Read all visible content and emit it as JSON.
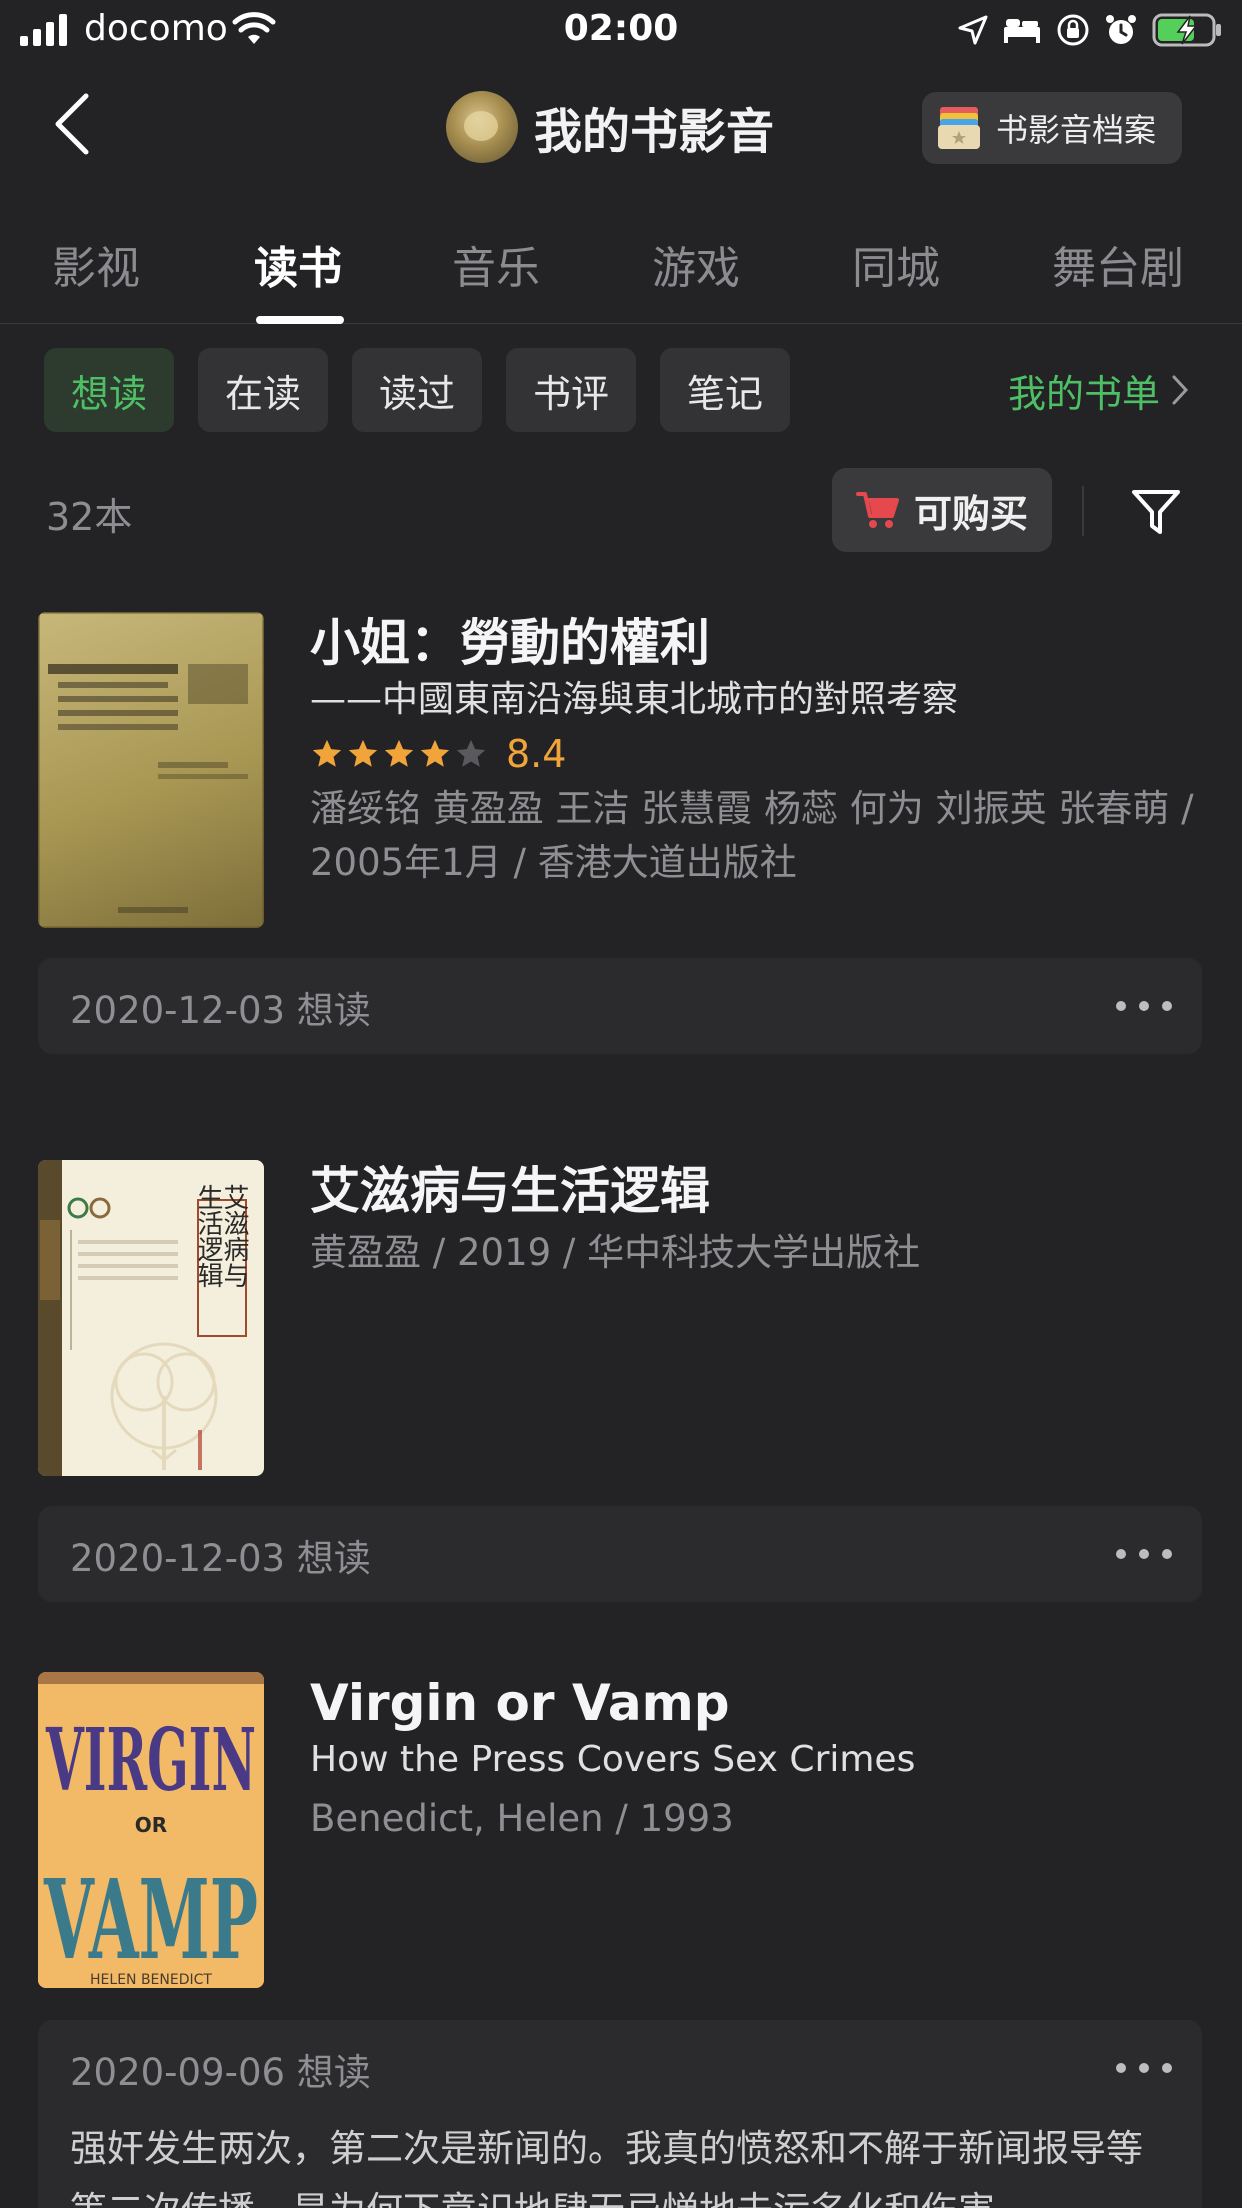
{
  "status_bar": {
    "carrier": "docomo",
    "time": "02:00"
  },
  "header": {
    "title": "我的书影音",
    "archive_label": "书影音档案"
  },
  "tabs": [
    {
      "label": "影视"
    },
    {
      "label": "读书"
    },
    {
      "label": "音乐"
    },
    {
      "label": "游戏"
    },
    {
      "label": "同城"
    },
    {
      "label": "舞台剧"
    }
  ],
  "active_tab": "读书",
  "chips": [
    {
      "label": "想读"
    },
    {
      "label": "在读"
    },
    {
      "label": "读过"
    },
    {
      "label": "书评"
    },
    {
      "label": "笔记"
    }
  ],
  "booklist_link": "我的书单",
  "count_label": "32本",
  "buy_label": "可购买",
  "books": [
    {
      "title": "小姐：勞動的權利",
      "subtitle": "——中國東南沿海與東北城市的對照考察",
      "rating": "8.4",
      "meta": "潘绥铭 黄盈盈 王洁 张慧霞 杨蕊 何为 刘振英 张春萌 / 2005年1月 / 香港大道出版社",
      "record": "2020-12-03 想读"
    },
    {
      "title": "艾滋病与生活逻辑",
      "meta": "黄盈盈 / 2019 / 华中科技大学出版社",
      "cover_text": "艾滋病与生活逻辑",
      "record": "2020-12-03 想读"
    },
    {
      "title": "Virgin or Vamp",
      "subtitle": "How the Press Covers Sex Crimes",
      "meta": "Benedict, Helen / 1993",
      "cover_text": {
        "top": "VIRGIN",
        "mid": "OR",
        "bottom": "VAMP",
        "author": "HELEN BENEDICT"
      },
      "record": "2020-09-06 想读",
      "review": "强奸发生两次，第二次是新闻的。我真的愤怒和不解于新闻报导等等二次传播，是为何下意识地肆无忌惮地去污名化和伤害"
    }
  ],
  "colors": {
    "background": "#232325",
    "accent_green": "#4fbf66",
    "rating_orange": "#f0a43a",
    "cart_red": "#e5484d"
  }
}
